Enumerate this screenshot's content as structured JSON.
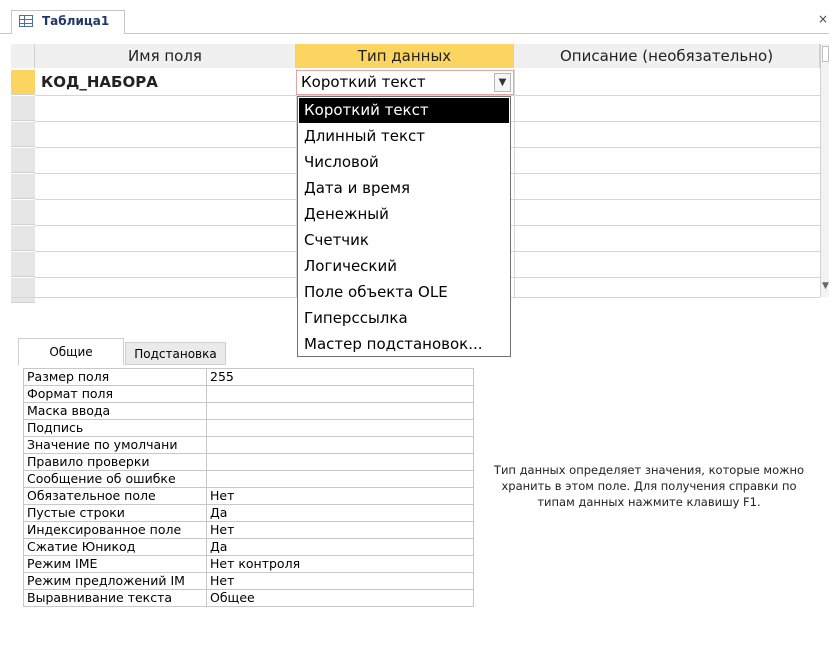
{
  "tab": {
    "title": "Таблица1",
    "close": "×"
  },
  "grid": {
    "headers": {
      "name": "Имя поля",
      "type": "Тип данных",
      "description": "Описание (необязательно)"
    },
    "rows": [
      {
        "name": "КОД_НАБОРА",
        "type": "Короткий текст",
        "description": ""
      }
    ]
  },
  "dropdown": {
    "selected": "Короткий текст",
    "options": [
      "Короткий текст",
      "Длинный текст",
      "Числовой",
      "Дата и время",
      "Денежный",
      "Счетчик",
      "Логический",
      "Поле объекта OLE",
      "Гиперссылка",
      "Мастер подстановок..."
    ]
  },
  "property_tabs": {
    "general": "Общие",
    "lookup": "Подстановка"
  },
  "properties": [
    {
      "label": "Размер поля",
      "value": "255"
    },
    {
      "label": "Формат поля",
      "value": ""
    },
    {
      "label": "Маска ввода",
      "value": ""
    },
    {
      "label": "Подпись",
      "value": ""
    },
    {
      "label": "Значение по умолчани",
      "value": ""
    },
    {
      "label": "Правило проверки",
      "value": ""
    },
    {
      "label": "Сообщение об ошибке",
      "value": ""
    },
    {
      "label": "Обязательное поле",
      "value": "Нет"
    },
    {
      "label": "Пустые строки",
      "value": "Да"
    },
    {
      "label": "Индексированное поле",
      "value": "Нет"
    },
    {
      "label": "Сжатие Юникод",
      "value": "Да"
    },
    {
      "label": "Режим IME",
      "value": "Нет контроля"
    },
    {
      "label": "Режим предложений IM",
      "value": "Нет"
    },
    {
      "label": "Выравнивание текста",
      "value": "Общее"
    }
  ],
  "help_text": "Тип данных определяет значения, которые можно хранить в этом поле. Для получения справки по типам данных нажмите клавишу F1.",
  "colors": {
    "accent": "#fbd55f",
    "tab_title": "#1f3864",
    "selected_option_bg": "#000000"
  },
  "icons": {
    "tab": "table-icon",
    "combo": "chevron-down-icon",
    "close": "close-icon"
  }
}
